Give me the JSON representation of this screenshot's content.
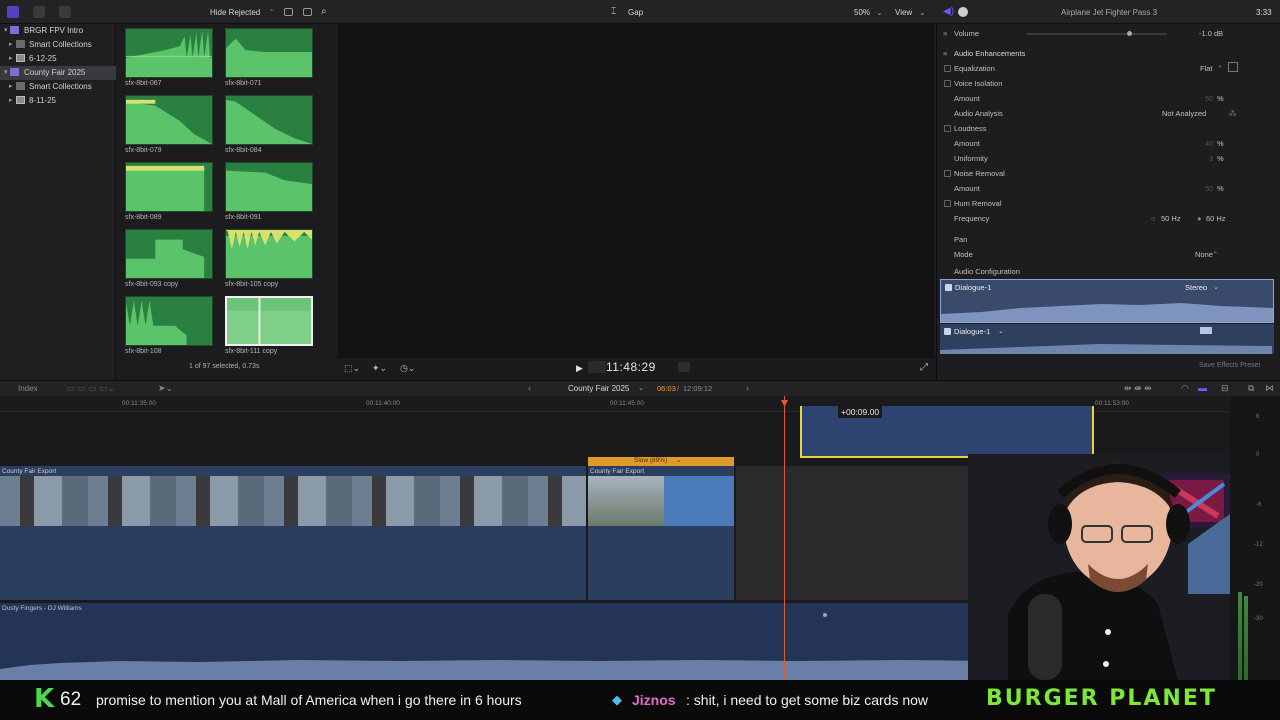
{
  "topbar": {
    "hide_rejected": "Hide Rejected",
    "viewer_clip_name": "Gap",
    "zoom": "50%",
    "view_menu": "View",
    "inspector_title": "Airplane Jet Fighter Pass 3",
    "inspector_duration": "3:33"
  },
  "libraries": [
    {
      "label": "BRGR FPV Intro",
      "level": 0,
      "selected": false
    },
    {
      "label": "Smart Collections",
      "level": 1,
      "selected": false
    },
    {
      "label": "6-12-25",
      "level": 1,
      "selected": false
    },
    {
      "label": "County Fair 2025",
      "level": 0,
      "selected": true
    },
    {
      "label": "Smart Collections",
      "level": 1,
      "selected": false
    },
    {
      "label": "8-11-25",
      "level": 1,
      "selected": false
    }
  ],
  "browser": {
    "clips": [
      {
        "name": "sfx-8bit-067"
      },
      {
        "name": "sfx-8bit-071"
      },
      {
        "name": "sfx-8bit-079"
      },
      {
        "name": "sfx-8bit-084"
      },
      {
        "name": "sfx-8bit-089"
      },
      {
        "name": "sfx-8bit-091"
      },
      {
        "name": "sfx-8bit-093 copy"
      },
      {
        "name": "sfx-8bit-105 copy"
      },
      {
        "name": "sfx-8bit-108"
      },
      {
        "name": "sfx-8bit-111 copy"
      }
    ],
    "status": "1 of 97 selected, 0.73s"
  },
  "viewer": {
    "timecode": "11:48:29"
  },
  "inspector": {
    "volume_label": "Volume",
    "volume_value": "-1.0 dB",
    "audio_enhancements": "Audio Enhancements",
    "equalization": "Equalization",
    "equalization_value": "Flat",
    "voice_isolation": "Voice Isolation",
    "amount": "Amount",
    "amount_value_1": "50",
    "pct": "%",
    "audio_analysis": "Audio Analysis",
    "audio_analysis_value": "Not Analyzed",
    "loudness": "Loudness",
    "amount_value_2": "40",
    "uniformity": "Uniformity",
    "uniformity_value": "3",
    "noise_removal": "Noise Removal",
    "amount_value_3": "50",
    "hum_removal": "Hum Removal",
    "frequency": "Frequency",
    "freq_50": "50 Hz",
    "freq_60": "60 Hz",
    "pan": "Pan",
    "mode": "Mode",
    "mode_value": "None",
    "audio_configuration": "Audio Configuration",
    "component_1": "Dialogue-1",
    "component_1_channels": "Stereo",
    "component_2": "Dialogue-1",
    "save_effects_preset": "Save Effects Preset"
  },
  "timeline": {
    "index": "Index",
    "project_name": "County Fair 2025",
    "timecode_position": "06:03",
    "timecode_total": "12:09:12",
    "ruler_ticks": [
      "00:11:35:00",
      "00:11:40:00",
      "00:11:45:00",
      "00:11:53:00"
    ],
    "gap_duration": "+00:09.00",
    "speed_label": "Slow (89%)",
    "clip_1_name": "County Fair Export",
    "clip_2_name": "County Fair Export",
    "music_clip_name": "Dusty Fingers - DJ Williams",
    "meter_ticks": [
      "6",
      "0",
      "-6",
      "-12",
      "-20",
      "-30"
    ]
  },
  "ticker": {
    "badge_letter": "K",
    "badge_count": "62",
    "message_text": "promise to mention you at Mall of America when i go there in 6 hours",
    "username": "Jiznos",
    "username_message": ": shit, i need to get some biz cards now",
    "brand": "BURGER PLANET"
  }
}
